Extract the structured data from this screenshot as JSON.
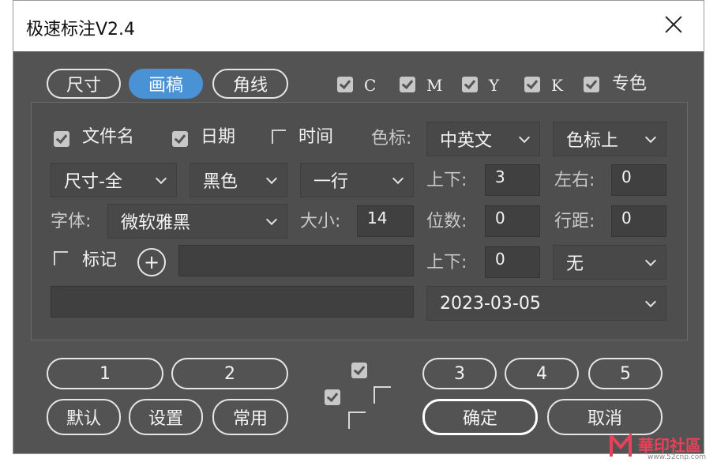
{
  "window": {
    "title": "极速标注V2.4"
  },
  "tabs": [
    {
      "label": "尺寸",
      "active": false
    },
    {
      "label": "画稿",
      "active": true
    },
    {
      "label": "角线",
      "active": false
    }
  ],
  "colors_checks": [
    {
      "label": "C",
      "checked": true
    },
    {
      "label": "M",
      "checked": true
    },
    {
      "label": "Y",
      "checked": true
    },
    {
      "label": "K",
      "checked": true
    },
    {
      "label": "专色",
      "checked": true
    }
  ],
  "options": {
    "filename": {
      "label": "文件名",
      "checked": true
    },
    "date": {
      "label": "日期",
      "checked": true
    },
    "time": {
      "label": "时间",
      "checked": false
    },
    "color_mark_label": "色标:",
    "color_mark_lang": "中英文",
    "color_mark_pos": "色标上"
  },
  "row2": {
    "size_mode": "尺寸-全",
    "color": "黑色",
    "lines": "一行",
    "updown_label": "上下:",
    "updown_value": "3",
    "leftright_label": "左右:",
    "leftright_value": "0"
  },
  "row3": {
    "font_label": "字体:",
    "font_value": "微软雅黑",
    "size_label": "大小:",
    "size_value": "14",
    "digits_label": "位数:",
    "digits_value": "0",
    "linespacing_label": "行距:",
    "linespacing_value": "0"
  },
  "row4": {
    "mark": {
      "label": "标记",
      "checked": false
    },
    "add_symbol": "+",
    "mark_text": "",
    "updown_label": "上下:",
    "updown_value": "0",
    "position_select": "无"
  },
  "row5": {
    "free_text": "",
    "date_value": "2023-03-05"
  },
  "presets": [
    "1",
    "2",
    "3",
    "4",
    "5"
  ],
  "actions": {
    "default": "默认",
    "settings": "设置",
    "common": "常用",
    "ok": "确定",
    "cancel": "取消"
  },
  "watermark": {
    "text": "華印社區",
    "url": "www.52cnp.com"
  },
  "accent_color": "#4a92d6"
}
